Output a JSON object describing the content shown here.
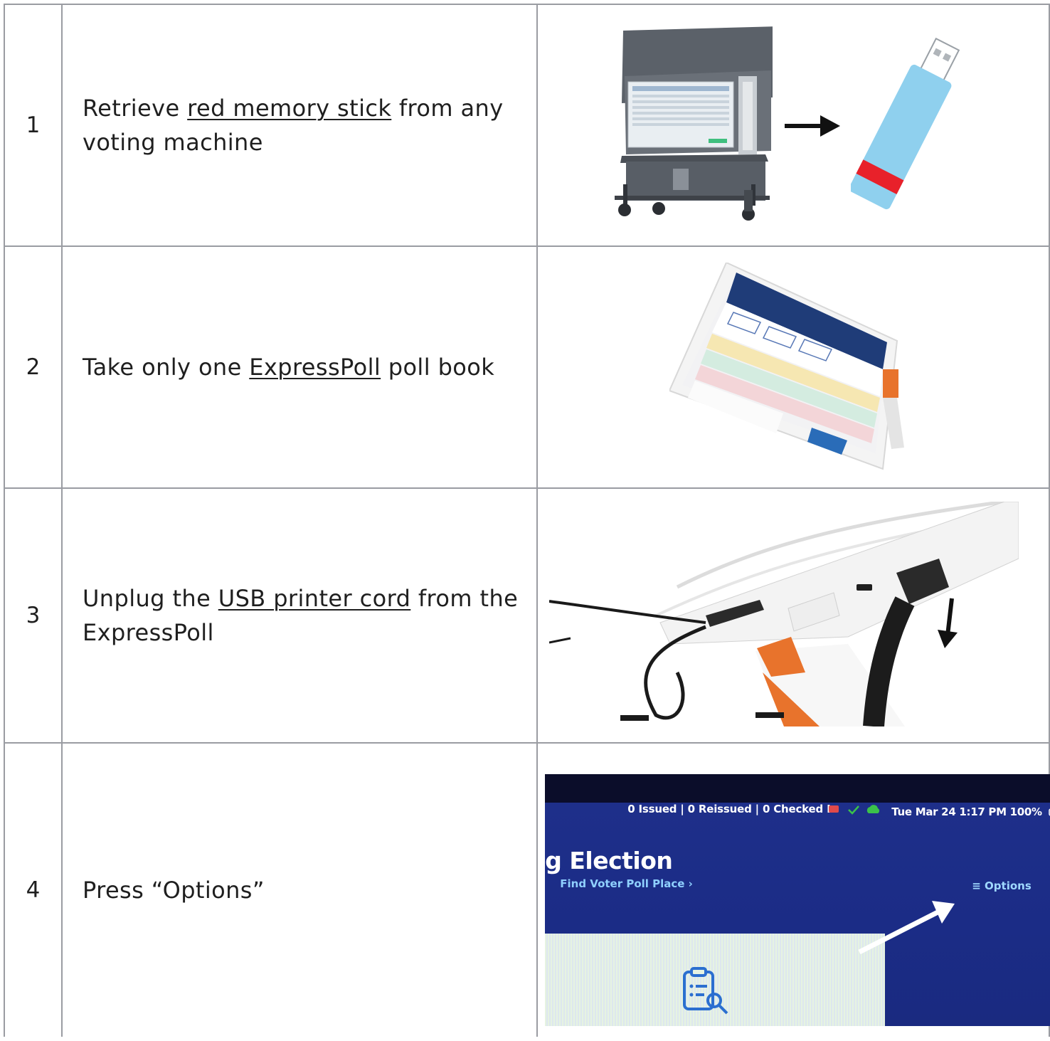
{
  "rows": [
    {
      "number": "1",
      "text": [
        "Retrieve ",
        "red memory stick",
        " from any voting machine"
      ],
      "image_icons": [
        "voting-machine-image",
        "arrow-right-icon",
        "usb-memory-stick-image"
      ]
    },
    {
      "number": "2",
      "text": [
        "Take only one ",
        "ExpressPoll",
        " poll book"
      ],
      "image_icons": [
        "expresspoll-tablet-image"
      ]
    },
    {
      "number": "3",
      "text": [
        "Unplug the ",
        "USB printer cord",
        " from the ExpressPoll"
      ],
      "image_icons": [
        "usb-cord-photo",
        "arrow-down-icon"
      ]
    },
    {
      "number": "4",
      "text": [
        "Press “Options”",
        "",
        ""
      ],
      "image_icons": [
        "expresspoll-screen-photo"
      ],
      "screen": {
        "status": "0 Issued | 0 Reissued | 0 Checked In",
        "datetime": "Tue Mar 24  1:17 PM  100%",
        "title": "g Election",
        "link": "Find Voter Poll Place ›",
        "options": "≡ Options"
      }
    }
  ],
  "colors": {
    "border": "#9a9ca2",
    "usb_body": "#8fd0ee",
    "usb_band": "#e8212a",
    "screen_bg": "#1e2f8a",
    "orange_clip": "#e8732c"
  }
}
